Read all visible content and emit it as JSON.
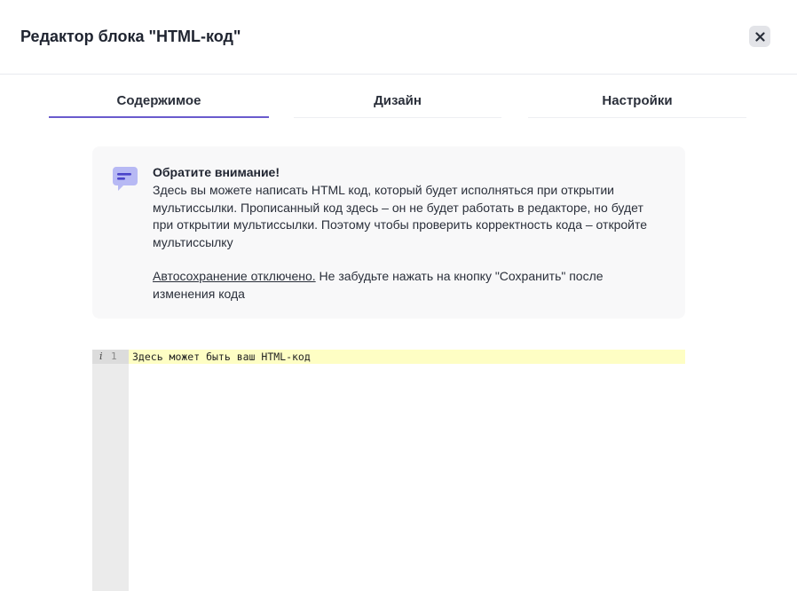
{
  "dialog": {
    "title": "Редактор блока \"HTML-код\""
  },
  "tabs": [
    {
      "label": "Содержимое",
      "active": true
    },
    {
      "label": "Дизайн",
      "active": false
    },
    {
      "label": "Настройки",
      "active": false
    }
  ],
  "notice": {
    "title": "Обратите внимание!",
    "text": "Здесь вы можете написать HTML код, который будет исполняться при открытии мультиссылки. Прописанный код здесь – он не будет работать в редакторе, но будет при открытии мультиссылки. Поэтому чтобы проверить корректность кода – откройте мультиссылку",
    "autosave_link": "Автосохранение отключено.",
    "autosave_text": " Не забудьте нажать на кнопку \"Сохранить\" после изменения кода"
  },
  "editor": {
    "info_icon": "i",
    "line_number": "1",
    "code": "Здесь может быть ваш HTML-код"
  },
  "colors": {
    "accent": "#6a5acd",
    "icon_bubble": "#b7b9f4",
    "icon_lines": "#4b44c9",
    "active_line": "#fefec4"
  }
}
